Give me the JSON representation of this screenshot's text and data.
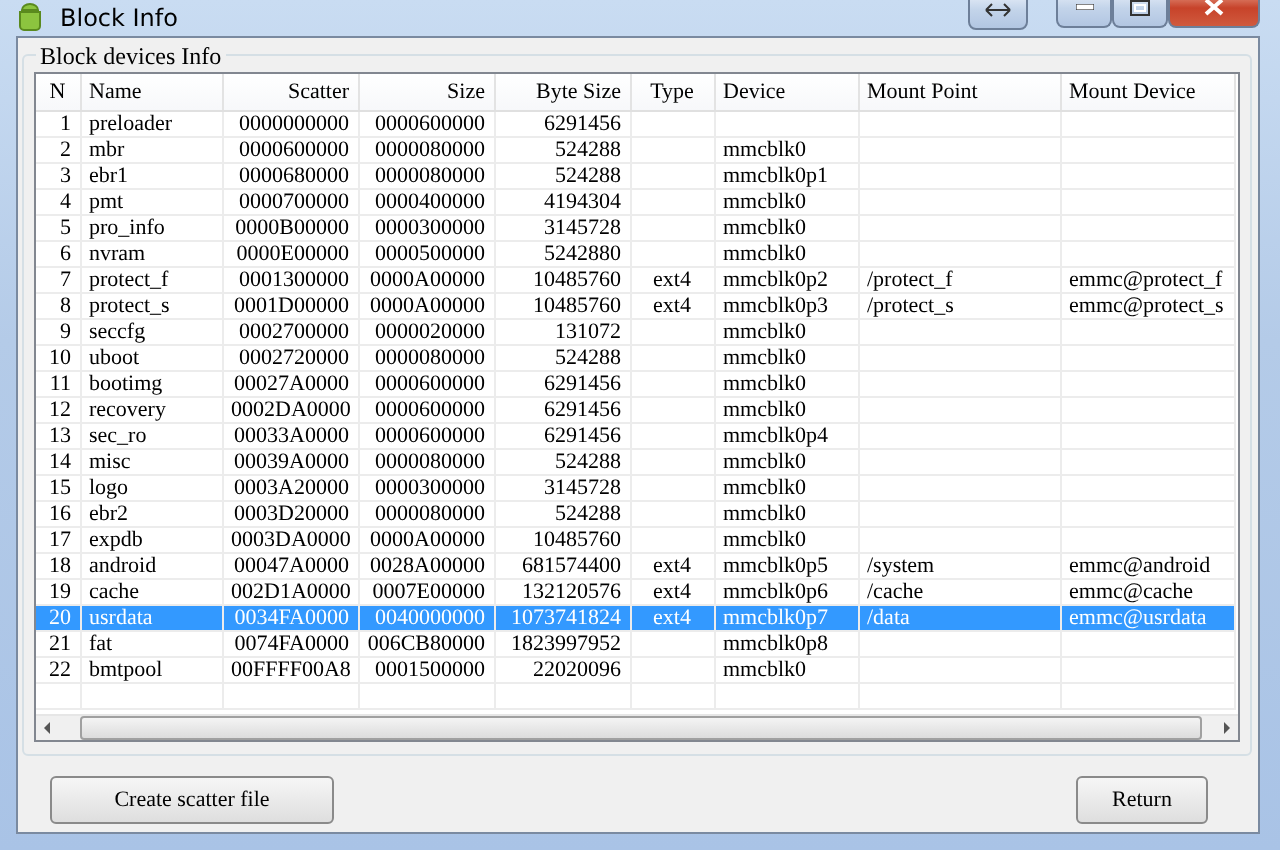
{
  "window": {
    "title": "Block Info"
  },
  "group": {
    "title": "Block devices Info"
  },
  "table": {
    "columns": [
      "N",
      "Name",
      "Scatter",
      "Size",
      "Byte Size",
      "Type",
      "Device",
      "Mount Point",
      "Mount Device"
    ],
    "rows": [
      {
        "selected": false,
        "cells": [
          "1",
          "preloader",
          "0000000000",
          "0000600000",
          "6291456",
          "",
          "",
          "",
          ""
        ]
      },
      {
        "selected": false,
        "cells": [
          "2",
          "mbr",
          "0000600000",
          "0000080000",
          "524288",
          "",
          "mmcblk0",
          "",
          ""
        ]
      },
      {
        "selected": false,
        "cells": [
          "3",
          "ebr1",
          "0000680000",
          "0000080000",
          "524288",
          "",
          "mmcblk0p1",
          "",
          ""
        ]
      },
      {
        "selected": false,
        "cells": [
          "4",
          "pmt",
          "0000700000",
          "0000400000",
          "4194304",
          "",
          "mmcblk0",
          "",
          ""
        ]
      },
      {
        "selected": false,
        "cells": [
          "5",
          "pro_info",
          "0000B00000",
          "0000300000",
          "3145728",
          "",
          "mmcblk0",
          "",
          ""
        ]
      },
      {
        "selected": false,
        "cells": [
          "6",
          "nvram",
          "0000E00000",
          "0000500000",
          "5242880",
          "",
          "mmcblk0",
          "",
          ""
        ]
      },
      {
        "selected": false,
        "cells": [
          "7",
          "protect_f",
          "0001300000",
          "0000A00000",
          "10485760",
          "ext4",
          "mmcblk0p2",
          "/protect_f",
          "emmc@protect_f"
        ]
      },
      {
        "selected": false,
        "cells": [
          "8",
          "protect_s",
          "0001D00000",
          "0000A00000",
          "10485760",
          "ext4",
          "mmcblk0p3",
          "/protect_s",
          "emmc@protect_s"
        ]
      },
      {
        "selected": false,
        "cells": [
          "9",
          "seccfg",
          "0002700000",
          "0000020000",
          "131072",
          "",
          "mmcblk0",
          "",
          ""
        ]
      },
      {
        "selected": false,
        "cells": [
          "10",
          "uboot",
          "0002720000",
          "0000080000",
          "524288",
          "",
          "mmcblk0",
          "",
          ""
        ]
      },
      {
        "selected": false,
        "cells": [
          "11",
          "bootimg",
          "00027A0000",
          "0000600000",
          "6291456",
          "",
          "mmcblk0",
          "",
          ""
        ]
      },
      {
        "selected": false,
        "cells": [
          "12",
          "recovery",
          "0002DA0000",
          "0000600000",
          "6291456",
          "",
          "mmcblk0",
          "",
          ""
        ]
      },
      {
        "selected": false,
        "cells": [
          "13",
          "sec_ro",
          "00033A0000",
          "0000600000",
          "6291456",
          "",
          "mmcblk0p4",
          "",
          ""
        ]
      },
      {
        "selected": false,
        "cells": [
          "14",
          "misc",
          "00039A0000",
          "0000080000",
          "524288",
          "",
          "mmcblk0",
          "",
          ""
        ]
      },
      {
        "selected": false,
        "cells": [
          "15",
          "logo",
          "0003A20000",
          "0000300000",
          "3145728",
          "",
          "mmcblk0",
          "",
          ""
        ]
      },
      {
        "selected": false,
        "cells": [
          "16",
          "ebr2",
          "0003D20000",
          "0000080000",
          "524288",
          "",
          "mmcblk0",
          "",
          ""
        ]
      },
      {
        "selected": false,
        "cells": [
          "17",
          "expdb",
          "0003DA0000",
          "0000A00000",
          "10485760",
          "",
          "mmcblk0",
          "",
          ""
        ]
      },
      {
        "selected": false,
        "cells": [
          "18",
          "android",
          "00047A0000",
          "0028A00000",
          "681574400",
          "ext4",
          "mmcblk0p5",
          "/system",
          "emmc@android"
        ]
      },
      {
        "selected": false,
        "cells": [
          "19",
          "cache",
          "002D1A0000",
          "0007E00000",
          "132120576",
          "ext4",
          "mmcblk0p6",
          "/cache",
          "emmc@cache"
        ]
      },
      {
        "selected": true,
        "cells": [
          "20",
          "usrdata",
          "0034FA0000",
          "0040000000",
          "1073741824",
          "ext4",
          "mmcblk0p7",
          "/data",
          "emmc@usrdata"
        ]
      },
      {
        "selected": false,
        "cells": [
          "21",
          "fat",
          "0074FA0000",
          "006CB80000",
          "1823997952",
          "",
          "mmcblk0p8",
          "",
          ""
        ]
      },
      {
        "selected": false,
        "cells": [
          "22",
          "bmtpool",
          "00FFFF00A8",
          "0001500000",
          "22020096",
          "",
          "mmcblk0",
          "",
          ""
        ]
      }
    ]
  },
  "buttons": [
    "Create scatter file",
    "Return"
  ]
}
